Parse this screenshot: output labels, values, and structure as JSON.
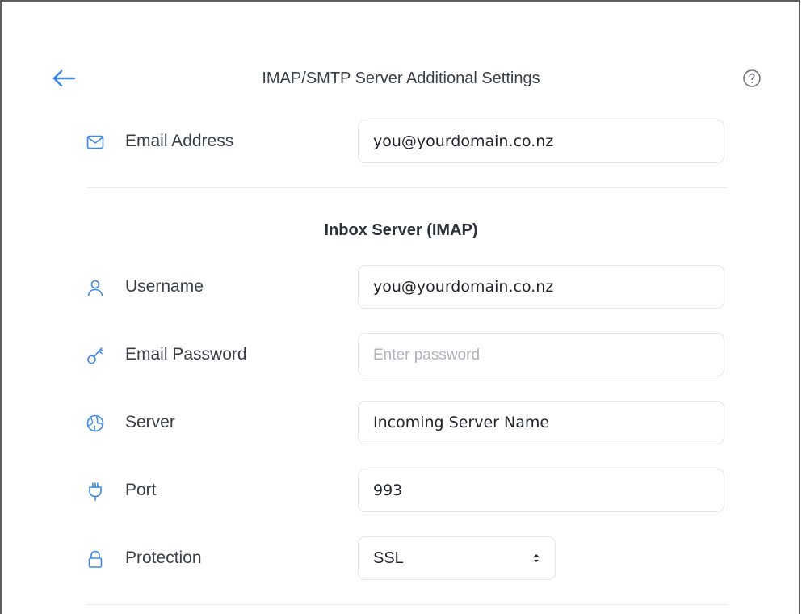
{
  "header": {
    "title": "IMAP/SMTP Server Additional Settings",
    "back_icon": "arrow-left-icon",
    "help_icon": "question-circle-icon"
  },
  "email_address": {
    "label": "Email Address",
    "value": "you@yourdomain.co.nz",
    "icon": "envelope-icon"
  },
  "inbox_section": {
    "title": "Inbox Server (IMAP)",
    "username": {
      "label": "Username",
      "value": "you@yourdomain.co.nz",
      "icon": "user-icon"
    },
    "password": {
      "label": "Email Password",
      "value": "",
      "placeholder": "Enter password",
      "icon": "key-icon"
    },
    "server": {
      "label": "Server",
      "value": "Incoming Server Name",
      "icon": "globe-icon"
    },
    "port": {
      "label": "Port",
      "value": "993",
      "icon": "plug-icon"
    },
    "protection": {
      "label": "Protection",
      "value": "SSL",
      "icon": "lock-icon"
    }
  },
  "colors": {
    "accent": "#3d8ae6",
    "text": "#3a3f46",
    "border": "#e3e5e8"
  }
}
